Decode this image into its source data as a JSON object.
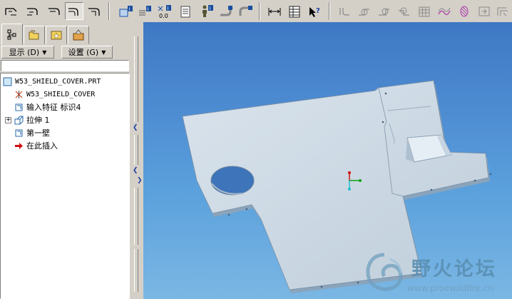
{
  "toolbar": {
    "buttons": [
      {
        "name": "datum-sketch-1-icon"
      },
      {
        "name": "datum-sketch-2-icon"
      },
      {
        "name": "datum-sketch-3-icon"
      },
      {
        "name": "datum-sketch-4-icon"
      },
      {
        "name": "datum-sketch-5-icon"
      },
      {
        "name": "model-info-icon"
      },
      {
        "name": "feature-info-icon"
      },
      {
        "name": "measure-value-icon",
        "label": "0.0"
      },
      {
        "name": "report-icon"
      },
      {
        "name": "mass-properties-icon"
      },
      {
        "name": "pipe-icon"
      },
      {
        "name": "bend-icon"
      },
      {
        "name": "dimension-icon"
      },
      {
        "name": "table-icon"
      },
      {
        "name": "whats-this-help-icon"
      },
      {
        "name": "wall-icon"
      },
      {
        "name": "flange-icon"
      },
      {
        "name": "extrude-wall-icon"
      },
      {
        "name": "unbend-icon"
      },
      {
        "name": "grid-icon"
      },
      {
        "name": "form-icon"
      },
      {
        "name": "punch-icon"
      },
      {
        "name": "bend-back-icon"
      },
      {
        "name": "rip-icon"
      }
    ]
  },
  "panel": {
    "menu_display": "显示 (D)",
    "menu_settings": "设置 (G)"
  },
  "tree": {
    "root": "W53_SHIELD_COVER.PRT",
    "items": [
      {
        "label": "W53_SHIELD_COVER",
        "icon": "coordinate-system-icon"
      },
      {
        "label": "输入特征 标识4",
        "icon": "import-feature-icon"
      },
      {
        "label": "拉伸 1",
        "icon": "extrude-feature-icon"
      },
      {
        "label": "第一壁",
        "icon": "first-wall-icon"
      },
      {
        "label": "在此插入",
        "icon": "insert-here-icon"
      }
    ]
  },
  "watermark": {
    "title": "野火论坛",
    "url": "www.proewildfire.cn"
  },
  "colors": {
    "viewport_top": "#3e78c4",
    "viewport_bottom": "#7bb7e4",
    "part_fill": "#c9d6e3",
    "insert_arrow": "#d01010"
  }
}
